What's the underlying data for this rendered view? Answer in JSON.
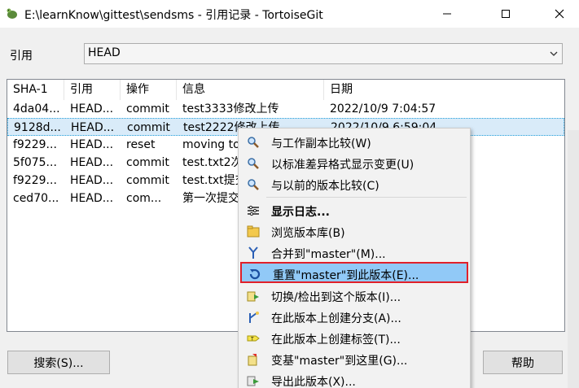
{
  "window": {
    "title": "E:\\learnKnow\\gittest\\sendsms - 引用记录 - TortoiseGit"
  },
  "ref": {
    "label": "引用",
    "value": "HEAD"
  },
  "columns": [
    "SHA-1",
    "引用",
    "操作",
    "信息",
    "日期"
  ],
  "rows": [
    {
      "sha": "4da04...",
      "ref": "HEAD...",
      "action": "commit",
      "message": "test3333修改上传",
      "date": "2022/10/9 7:04:57"
    },
    {
      "sha": "9128d...",
      "ref": "HEAD...",
      "action": "commit",
      "message": "test2222修改上传",
      "date": "2022/10/9 6:59:04"
    },
    {
      "sha": "f9229...",
      "ref": "HEAD...",
      "action": "reset",
      "message": "moving to",
      "date": ""
    },
    {
      "sha": "5f075...",
      "ref": "HEAD...",
      "action": "commit",
      "message": "test.txt2次",
      "date": ""
    },
    {
      "sha": "f9229...",
      "ref": "HEAD...",
      "action": "commit",
      "message": "test.txt提交",
      "date": ""
    },
    {
      "sha": "ced70...",
      "ref": "HEAD...",
      "action": "com...",
      "message": "第一次提交",
      "date": ""
    }
  ],
  "buttons": {
    "search": "搜索(S)...",
    "help": "帮助"
  },
  "context_menu": [
    {
      "label": "与工作副本比较(W)",
      "icon": "magnifier-compare-icon"
    },
    {
      "label": "以标准差异格式显示变更(U)",
      "icon": "magnifier-diff-icon"
    },
    {
      "label": "与以前的版本比较(C)",
      "icon": "magnifier-prev-icon"
    },
    {
      "label": "显示日志...",
      "icon": "log-lines-icon",
      "bold": true
    },
    {
      "label": "浏览版本库(B)",
      "icon": "repo-browser-icon"
    },
    {
      "label": "合并到\"master\"(M)...",
      "icon": "merge-icon"
    },
    {
      "label": "重置\"master\"到此版本(E)...",
      "icon": "reset-icon",
      "highlighted": true
    },
    {
      "label": "切换/检出到这个版本(I)...",
      "icon": "switch-icon"
    },
    {
      "label": "在此版本上创建分支(A)...",
      "icon": "branch-icon"
    },
    {
      "label": "在此版本上创建标签(T)...",
      "icon": "tag-icon"
    },
    {
      "label": "变基\"master\"到这里(G)...",
      "icon": "rebase-icon"
    },
    {
      "label": "导出此版本(X)...",
      "icon": "export-icon"
    }
  ]
}
